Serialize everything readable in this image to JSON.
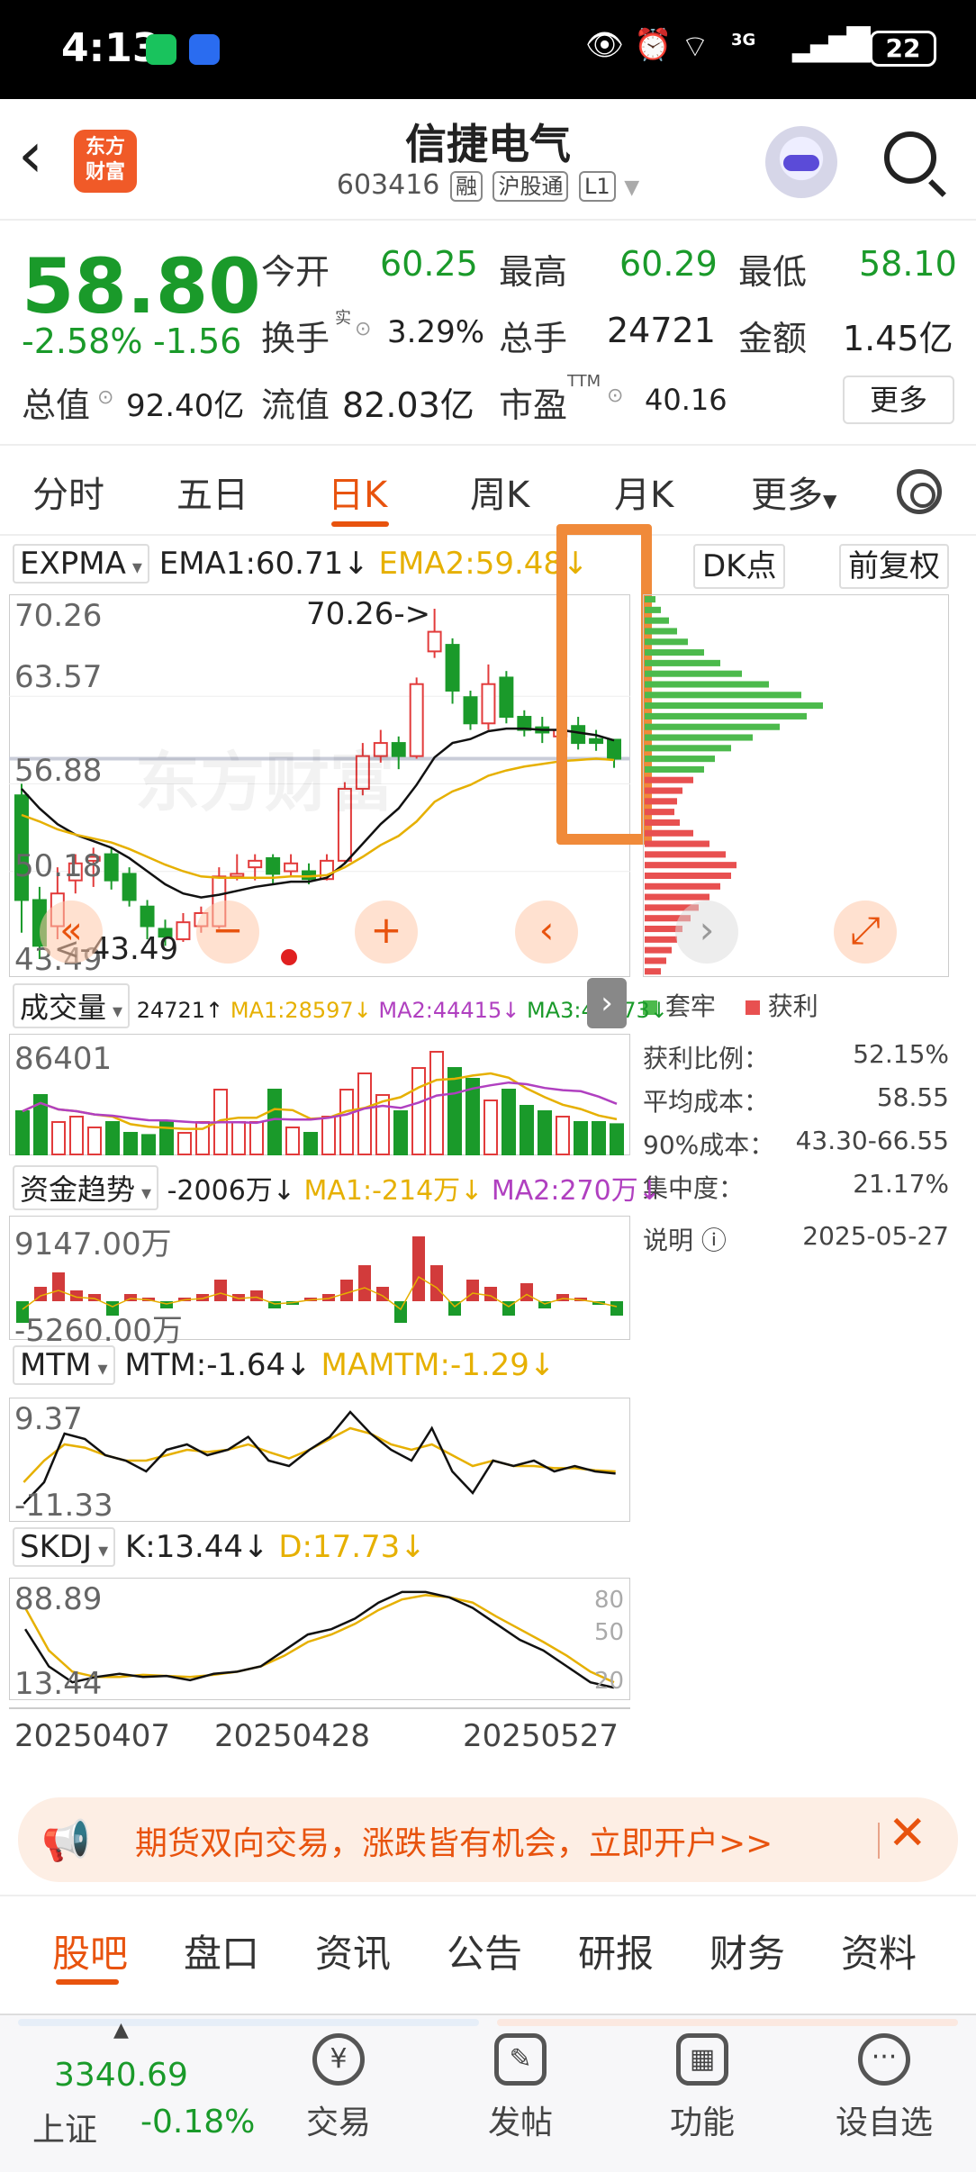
{
  "status": {
    "time": "4:13",
    "battery": "22",
    "signal_tag": "3G"
  },
  "header": {
    "back_icon": "back-arrow-icon",
    "app_logo_text_1": "东方",
    "app_logo_text_2": "财富",
    "name": "信捷电气",
    "code": "603416",
    "tags": [
      "融",
      "沪股通",
      "L1"
    ]
  },
  "quote": {
    "price": "58.80",
    "pct": "-2.58%",
    "chg": "-1.56",
    "open_lbl": "今开",
    "open": "60.25",
    "high_lbl": "最高",
    "high": "60.29",
    "low_lbl": "最低",
    "low": "58.10",
    "turnover_lbl": "换手",
    "turnover_sup": "实",
    "turnover": "3.29%",
    "vol_lbl": "总手",
    "vol": "24721",
    "amount_lbl": "金额",
    "amount": "1.45亿",
    "mcap_lbl": "总值",
    "mcap": "92.40亿",
    "float_lbl": "流值",
    "float": "82.03亿",
    "pe_lbl": "市盈",
    "pe_sup": "TTM",
    "pe": "40.16",
    "more": "更多"
  },
  "ktabs": [
    "分时",
    "五日",
    "日K",
    "周K",
    "月K",
    "更多"
  ],
  "ktabs_active": "日K",
  "main_ind": {
    "name": "EXPMA",
    "ema1": "EMA1:60.71↓",
    "ema2": "EMA2:59.48↓",
    "dk": "DK点",
    "adj": "前复权",
    "y_top": "70.26",
    "y_2": "63.57",
    "y_3": "56.88",
    "y_4": "50.18",
    "y_bottom": "43.49",
    "max_note": "70.26->",
    "min_note": "<-43.49",
    "watermark": "东方财富"
  },
  "chips": {
    "legend_trap": "套牢",
    "legend_profit": "获利",
    "profit_ratio_lbl": "获利比例：",
    "profit_ratio": "52.15%",
    "avg_cost_lbl": "平均成本：",
    "avg_cost": "58.55",
    "cost90_lbl": "90%成本：",
    "cost90": "43.30-66.55",
    "conc_lbl": "集中度：",
    "conc": "21.17%",
    "note_lbl": "说明",
    "date": "2025-05-27"
  },
  "volume": {
    "name": "成交量",
    "val": "24721↑",
    "ma1": "MA1:28597↓",
    "ma2": "MA2:44415↓",
    "ma3": "MA3:44573↓",
    "y_top": "86401"
  },
  "fund": {
    "name": "资金趋势",
    "val": "-2006万↓",
    "ma1": "MA1:-214万↓",
    "ma2": "MA2:270万↓",
    "y_top": "9147.00万",
    "y_bottom": "-5260.00万"
  },
  "mtm": {
    "name": "MTM",
    "val": "MTM:-1.64↓",
    "ma": "MAMTM:-1.29↓",
    "y_top": "9.37",
    "y_bottom": "-11.33"
  },
  "skdj": {
    "name": "SKDJ",
    "k": "K:13.44↓",
    "d": "D:17.73↓",
    "y_top": "88.89",
    "y_bottom": "13.44",
    "r80": "80",
    "r50": "50",
    "r20": "20"
  },
  "dates": [
    "20250407",
    "20250428",
    "20250527"
  ],
  "banner": {
    "text": "期货双向交易，涨跌皆有机会，立即开户>>"
  },
  "btabs": [
    "股吧",
    "盘口",
    "资讯",
    "公告",
    "研报",
    "财务",
    "资料"
  ],
  "btabs_active": "股吧",
  "bottom": {
    "index_val": "3340.69",
    "index_name": "上证",
    "index_pct": "-0.18%",
    "trade": "交易",
    "post": "发帖",
    "func": "功能",
    "watch": "设自选"
  },
  "colors": {
    "up": "#e23b3b",
    "down": "#1a9a2a",
    "accent": "#e8530e",
    "ema2": "#e6b000",
    "highlight": "#f08a3a"
  },
  "chart_data": {
    "type": "candlestick",
    "x_range": [
      "20250407",
      "20250527"
    ],
    "y_range": [
      43.49,
      70.26
    ],
    "candles": [
      {
        "o": 56.0,
        "c": 48.0,
        "h": 56.88,
        "l": 45.5
      },
      {
        "o": 48.0,
        "c": 44.5,
        "h": 49.0,
        "l": 43.49
      },
      {
        "o": 46.0,
        "c": 48.5,
        "h": 50.5,
        "l": 45.0
      },
      {
        "o": 49.5,
        "c": 50.8,
        "h": 51.5,
        "l": 48.5
      },
      {
        "o": 51.0,
        "c": 51.3,
        "h": 52.0,
        "l": 49.0
      },
      {
        "o": 51.5,
        "c": 49.5,
        "h": 52.0,
        "l": 48.8
      },
      {
        "o": 50.0,
        "c": 48.0,
        "h": 50.5,
        "l": 47.5
      },
      {
        "o": 47.5,
        "c": 46.0,
        "h": 48.0,
        "l": 45.0
      },
      {
        "o": 45.8,
        "c": 45.2,
        "h": 46.5,
        "l": 44.5
      },
      {
        "o": 45.0,
        "c": 46.3,
        "h": 47.0,
        "l": 44.8
      },
      {
        "o": 46.0,
        "c": 47.0,
        "h": 47.5,
        "l": 45.5
      },
      {
        "o": 46.0,
        "c": 49.8,
        "h": 50.5,
        "l": 45.8
      },
      {
        "o": 49.8,
        "c": 50.0,
        "h": 51.5,
        "l": 49.5
      },
      {
        "o": 50.5,
        "c": 51.0,
        "h": 51.5,
        "l": 49.5
      },
      {
        "o": 51.2,
        "c": 50.0,
        "h": 51.5,
        "l": 49.2
      },
      {
        "o": 50.2,
        "c": 50.8,
        "h": 51.5,
        "l": 49.8
      },
      {
        "o": 50.2,
        "c": 49.6,
        "h": 50.8,
        "l": 49.2
      },
      {
        "o": 49.6,
        "c": 51.0,
        "h": 51.5,
        "l": 49.5
      },
      {
        "o": 51.0,
        "c": 56.5,
        "h": 57.0,
        "l": 50.8
      },
      {
        "o": 56.5,
        "c": 59.0,
        "h": 60.0,
        "l": 56.0
      },
      {
        "o": 59.0,
        "c": 60.0,
        "h": 61.0,
        "l": 58.5
      },
      {
        "o": 60.0,
        "c": 59.0,
        "h": 60.5,
        "l": 58.0
      },
      {
        "o": 59.0,
        "c": 64.5,
        "h": 65.0,
        "l": 58.8
      },
      {
        "o": 67.0,
        "c": 68.5,
        "h": 70.26,
        "l": 66.5
      },
      {
        "o": 67.5,
        "c": 64.0,
        "h": 68.0,
        "l": 63.0
      },
      {
        "o": 63.5,
        "c": 61.5,
        "h": 64.0,
        "l": 61.0
      },
      {
        "o": 61.5,
        "c": 64.5,
        "h": 66.0,
        "l": 61.0
      },
      {
        "o": 65.0,
        "c": 62.0,
        "h": 65.5,
        "l": 61.5
      },
      {
        "o": 62.0,
        "c": 61.0,
        "h": 62.5,
        "l": 60.5
      },
      {
        "o": 61.2,
        "c": 60.8,
        "h": 62.0,
        "l": 60.0
      },
      {
        "o": 60.5,
        "c": 61.0,
        "h": 61.8,
        "l": 60.0
      },
      {
        "o": 61.3,
        "c": 60.0,
        "h": 62.0,
        "l": 59.5
      },
      {
        "o": 60.3,
        "c": 60.0,
        "h": 61.0,
        "l": 59.4
      },
      {
        "o": 60.25,
        "c": 58.8,
        "h": 60.29,
        "l": 58.1
      }
    ],
    "series": [
      {
        "name": "EMA1",
        "values": [
          56.5,
          55.0,
          53.8,
          53.0,
          52.5,
          52.0,
          51.2,
          50.2,
          49.2,
          48.5,
          48.2,
          48.4,
          48.7,
          49.0,
          49.2,
          49.4,
          49.4,
          49.7,
          50.8,
          52.3,
          53.8,
          55.0,
          56.8,
          58.9,
          60.0,
          60.3,
          60.9,
          61.1,
          61.1,
          61.0,
          61.0,
          60.8,
          60.6,
          60.2
        ]
      },
      {
        "name": "EMA2",
        "values": [
          54.5,
          54.0,
          53.4,
          53.0,
          52.7,
          52.4,
          51.9,
          51.3,
          50.7,
          50.2,
          49.8,
          49.7,
          49.7,
          49.7,
          49.7,
          49.8,
          49.8,
          49.9,
          50.5,
          51.3,
          52.2,
          52.9,
          54.0,
          55.5,
          56.3,
          56.8,
          57.5,
          57.9,
          58.2,
          58.4,
          58.6,
          58.7,
          58.8,
          58.7
        ]
      }
    ]
  }
}
